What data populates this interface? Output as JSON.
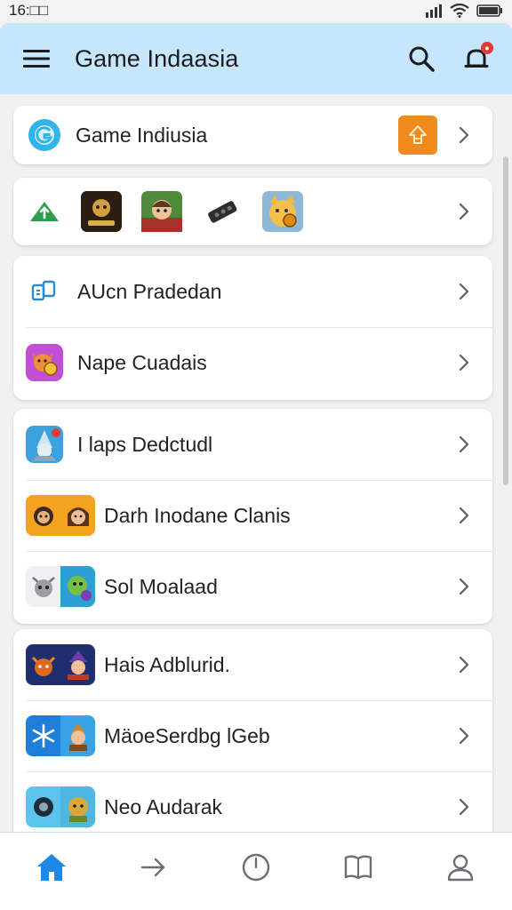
{
  "status_bar": {
    "time": "16:□□"
  },
  "app_bar": {
    "title": "Game Indaasia"
  },
  "featured": {
    "label": "Game Indiusia"
  },
  "list_group_1": [
    {
      "label": "AUcn Pradedan",
      "icon": "cards-icon"
    },
    {
      "label": "Nape Cuadais",
      "icon": "fox-coin-icon"
    }
  ],
  "list_group_2": [
    {
      "label": "I laps Dedctudl",
      "icon": "wizard-icon"
    },
    {
      "label": "Darh Inodane Clanis",
      "icon": "warriors-icon"
    },
    {
      "label": "Sol Moalaad",
      "icon": "creatures-icon"
    }
  ],
  "list_group_3": [
    {
      "label": "Hais Adblurid.",
      "icon": "heroes-icon"
    },
    {
      "label": "MäoeSerdbg lGeb",
      "icon": "frost-icon"
    },
    {
      "label": "Neo Audarak",
      "icon": "adventure-icon"
    }
  ],
  "colors": {
    "app_bar_bg": "#c5e6fb",
    "accent": "#1e88e5",
    "badge_orange": "#f08a1c",
    "notification": "#e53935"
  }
}
